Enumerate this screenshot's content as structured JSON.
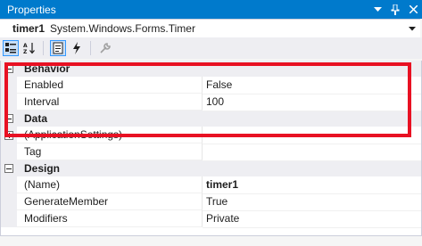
{
  "window": {
    "title": "Properties"
  },
  "object_selector": {
    "name": "timer1",
    "type": "System.Windows.Forms.Timer"
  },
  "categories": [
    {
      "name": "Behavior",
      "properties": [
        {
          "name": "Enabled",
          "value": "False"
        },
        {
          "name": "Interval",
          "value": "100"
        }
      ]
    },
    {
      "name": "Data",
      "properties": [
        {
          "name": "(ApplicationSettings)",
          "value": ""
        },
        {
          "name": "Tag",
          "value": ""
        }
      ]
    },
    {
      "name": "Design",
      "properties": [
        {
          "name": "(Name)",
          "value": "timer1"
        },
        {
          "name": "GenerateMember",
          "value": "True"
        },
        {
          "name": "Modifiers",
          "value": "Private"
        }
      ]
    }
  ],
  "colors": {
    "titlebar": "#007acc",
    "highlight": "#e81123"
  }
}
